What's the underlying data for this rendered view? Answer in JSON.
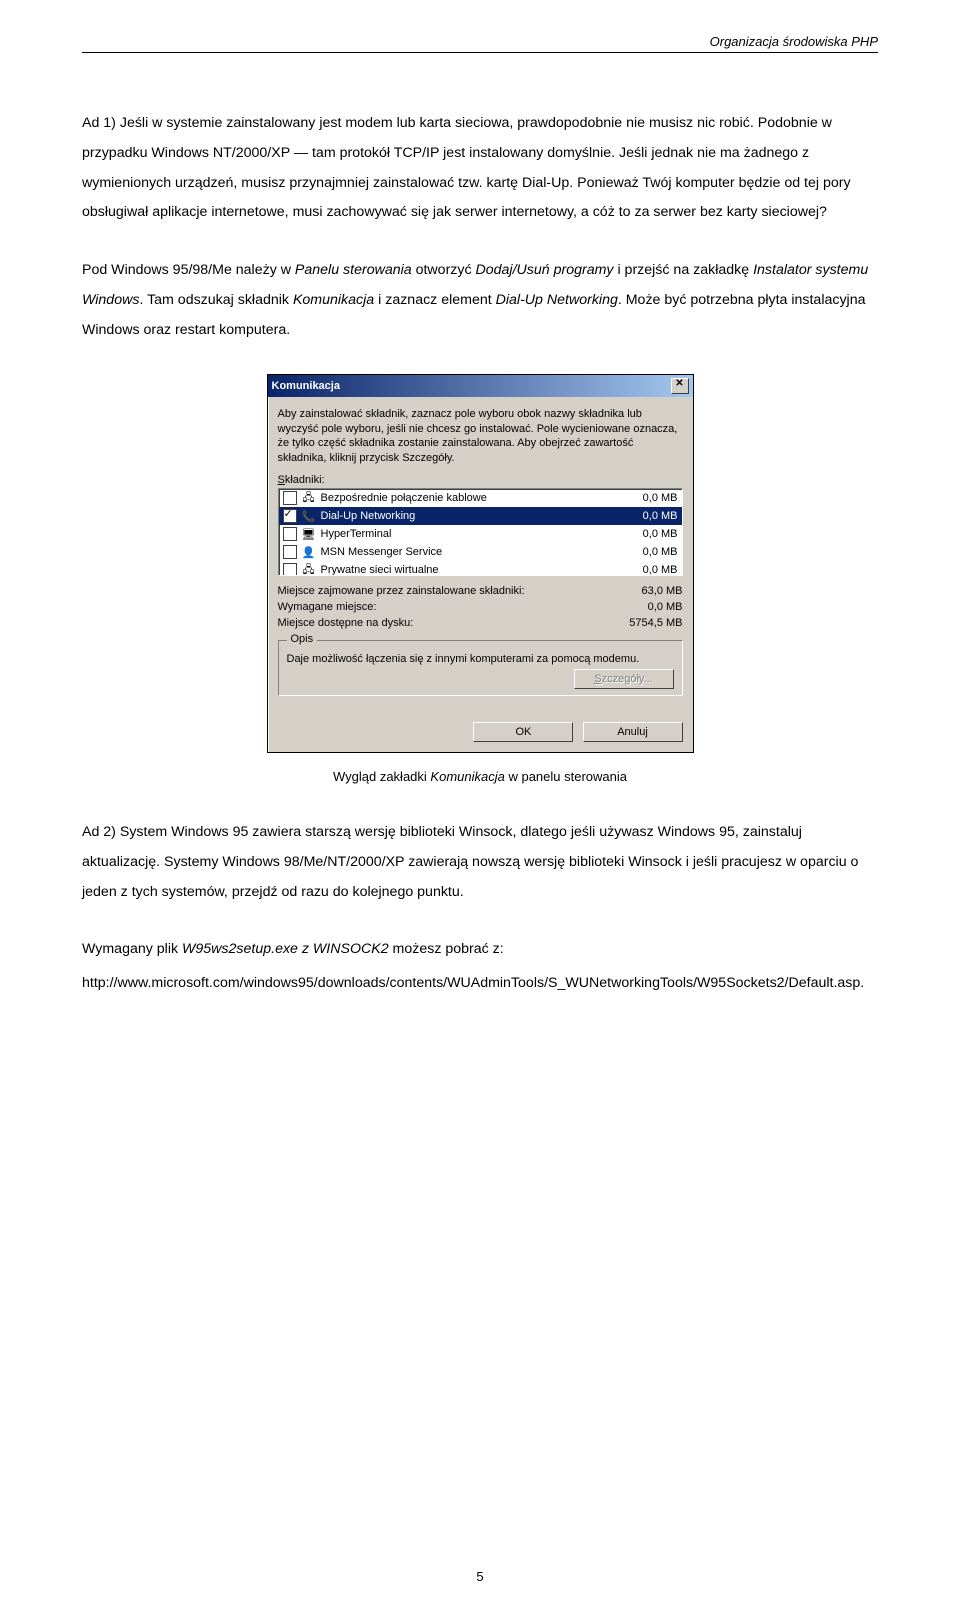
{
  "header": {
    "title": "Organizacja środowiska PHP"
  },
  "body": {
    "p1": "Ad 1) Jeśli w systemie zainstalowany jest modem lub karta sieciowa, prawdopodobnie nie musisz nic robić. Podobnie w przypadku Windows NT/2000/XP — tam protokół TCP/IP jest instalowany domyślnie. Jeśli jednak nie ma żadnego z wymienionych urządzeń, musisz przynajmniej zainstalować tzw. kartę Dial-Up. Ponieważ Twój komputer będzie od tej pory obsługiwał aplikacje internetowe, musi zachowywać się jak serwer internetowy, a cóż to za serwer bez karty sieciowej?",
    "p2_a": "Pod Windows 95/98/Me należy w ",
    "p2_b": "Panelu sterowania",
    "p2_c": " otworzyć ",
    "p2_d": "Dodaj/Usuń programy",
    "p2_e": " i przejść na zakładkę ",
    "p2_f": "Instalator systemu Windows",
    "p2_g": ". Tam odszukaj składnik ",
    "p2_h": "Komunikacja",
    "p2_i": " i zaznacz element ",
    "p2_j": "Dial-Up Networking",
    "p2_k": ". Może być potrzebna płyta instalacyjna Windows oraz restart komputera.",
    "caption_a": "Wygląd zakładki ",
    "caption_b": "Komunikacja",
    "caption_c": " w panelu sterowania",
    "p3": "Ad 2) System Windows 95 zawiera starszą wersję biblioteki Winsock, dlatego jeśli używasz Windows 95, zainstaluj aktualizację. Systemy Windows 98/Me/NT/2000/XP zawierają nowszą wersję biblioteki Winsock i jeśli pracujesz w oparciu o jeden z tych systemów, przejdź od razu do kolejnego punktu.",
    "p4_a": "Wymagany plik ",
    "p4_b": "W95ws2setup.exe z WINSOCK2",
    "p4_c": " możesz pobrać z:",
    "p5": "http://www.microsoft.com/windows95/downloads/contents/WUAdminTools/S_WUNetworkingTools/W95Sockets2/Default.asp."
  },
  "dialog": {
    "title": "Komunikacja",
    "intro": "Aby zainstalować składnik, zaznacz pole wyboru obok nazwy składnika lub wyczyść pole wyboru, jeśli nie chcesz go instalować. Pole wycieniowane oznacza, że tylko część składnika zostanie zainstalowana. Aby obejrzeć zawartość składnika, kliknij przycisk Szczegóły.",
    "components_prefix": "S",
    "components_label": "kładniki:",
    "items": [
      {
        "checked": false,
        "icon": "🖧",
        "name": "Bezpośrednie połączenie kablowe",
        "size": "0,0 MB"
      },
      {
        "checked": true,
        "icon": "📞",
        "name": "Dial-Up Networking",
        "size": "0,0 MB",
        "selected": true
      },
      {
        "checked": false,
        "icon": "🖥",
        "name": "HyperTerminal",
        "size": "0,0 MB"
      },
      {
        "checked": false,
        "icon": "👤",
        "name": "MSN Messenger Service",
        "size": "0,0 MB"
      },
      {
        "checked": false,
        "icon": "🖧",
        "name": "Prywatne sieci wirtualne",
        "size": "0,0 MB"
      }
    ],
    "stats": {
      "row1_label": "Miejsce zajmowane przez zainstalowane składniki:",
      "row1_val": "63,0 MB",
      "row2_label": "Wymagane miejsce:",
      "row2_val": "0,0 MB",
      "row3_label": "Miejsce dostępne na dysku:",
      "row3_val": "5754,5 MB"
    },
    "group_title": "Opis",
    "group_text": "Daje możliwość łączenia się z innymi komputerami za pomocą modemu.",
    "details_btn_prefix": "S",
    "details_btn_rest": "zczegóły...",
    "ok": "OK",
    "cancel": "Anuluj"
  },
  "pagenum": "5"
}
